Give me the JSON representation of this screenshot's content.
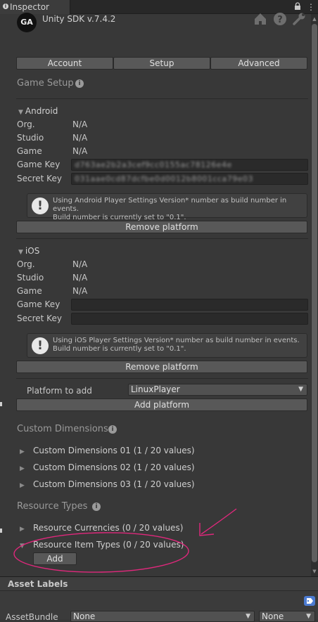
{
  "tab": {
    "title": "Inspector"
  },
  "header": {
    "logo_text": "GA",
    "title": "Unity SDK v.7.4.2"
  },
  "toolbar": {
    "tabs": [
      "Account",
      "Setup",
      "Advanced"
    ]
  },
  "game_setup": {
    "title": "Game Setup",
    "android": {
      "name": "Android",
      "org_label": "Org.",
      "org_value": "N/A",
      "studio_label": "Studio",
      "studio_value": "N/A",
      "game_label": "Game",
      "game_value": "N/A",
      "game_key_label": "Game Key",
      "game_key_value": "d763ae2b2a3cef9cc0155ac78126e4e",
      "secret_key_label": "Secret Key",
      "secret_key_value": "031aae0cd87dcfbe0d0012b8001cca79e03",
      "help_line1": "Using Android Player Settings Version* number as build number in events.",
      "help_line2": "Build number is currently set to \"0.1\".",
      "remove_label": "Remove platform"
    },
    "ios": {
      "name": "iOS",
      "org_label": "Org.",
      "org_value": "N/A",
      "studio_label": "Studio",
      "studio_value": "N/A",
      "game_label": "Game",
      "game_value": "N/A",
      "game_key_label": "Game Key",
      "game_key_value": "",
      "secret_key_label": "Secret Key",
      "secret_key_value": "",
      "help_line1": "Using iOS Player Settings Version* number as build number in events.",
      "help_line2": "Build number is currently set to \"0.1\".",
      "remove_label": "Remove platform"
    },
    "platform_to_add_label": "Platform to add",
    "platform_selected": "LinuxPlayer",
    "add_platform_label": "Add platform"
  },
  "custom_dimensions": {
    "title": "Custom Dimensions",
    "items": [
      "Custom Dimensions 01 (1 / 20 values)",
      "Custom Dimensions 02 (1 / 20 values)",
      "Custom Dimensions 03 (1 / 20 values)"
    ]
  },
  "resource_types": {
    "title": "Resource Types",
    "items": [
      "Resource Currencies (0 / 20 values)",
      "Resource Item Types (0 / 20 values)"
    ],
    "add_label": "Add"
  },
  "asset_labels": {
    "title": "Asset Labels",
    "bundle_label": "AssetBundle",
    "bundle_value": "None",
    "variant_value": "None"
  },
  "colors": {
    "annotation": "#e0287c",
    "tag": "#4c7bd1"
  }
}
